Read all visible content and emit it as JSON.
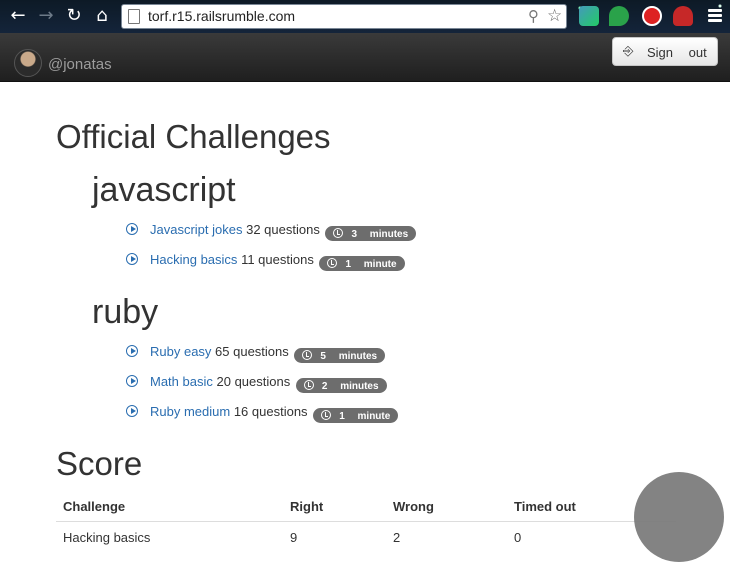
{
  "browser": {
    "url": "torf.r15.railsrumble.com",
    "nav": {
      "back_icon": "back-arrow-icon",
      "forward_icon": "forward-arrow-icon",
      "reload_icon": "reload-icon",
      "home_icon": "home-icon"
    },
    "nav_glyphs": {
      "back": "←",
      "forward": "→",
      "reload": "↻",
      "home": "⌂",
      "zoom": "⚲",
      "star": "☆"
    }
  },
  "navbar": {
    "username": "@jonatas",
    "signout_icon": "⎆",
    "signout_label": "Sign out"
  },
  "official": {
    "title": "Official Challenges",
    "languages": [
      {
        "name": "javascript",
        "challenges": [
          {
            "title": "Javascript jokes",
            "questions": "32 questions",
            "time": "3 minutes"
          },
          {
            "title": "Hacking basics",
            "questions": "11 questions",
            "time": "1 minute"
          }
        ]
      },
      {
        "name": "ruby",
        "challenges": [
          {
            "title": "Ruby easy",
            "questions": "65 questions",
            "time": "5 minutes"
          },
          {
            "title": "Math basic",
            "questions": "20 questions",
            "time": "2 minutes"
          },
          {
            "title": "Ruby medium",
            "questions": "16 questions",
            "time": "1 minute"
          }
        ]
      }
    ]
  },
  "score": {
    "title": "Score",
    "columns": [
      "Challenge",
      "Right",
      "Wrong",
      "Timed out"
    ],
    "rows": [
      [
        "Hacking basics",
        "9",
        "2",
        "0"
      ]
    ]
  },
  "colors": {
    "link": "#2a6db0",
    "badge": "#6d6d6d",
    "navbar": "#2b2b2b"
  }
}
